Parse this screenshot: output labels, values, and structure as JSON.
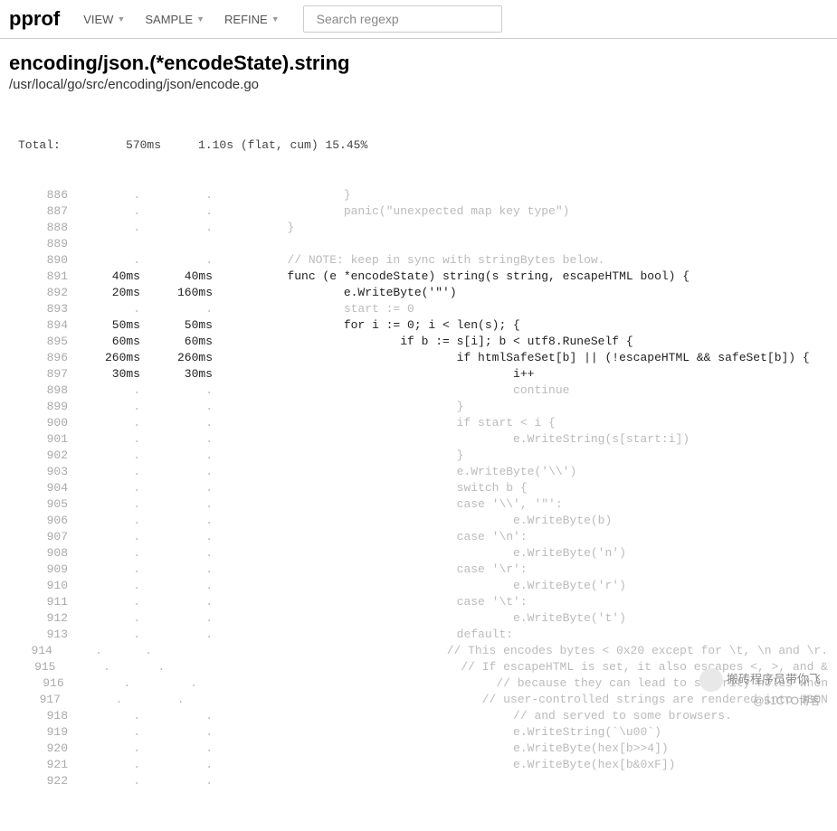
{
  "toolbar": {
    "brand": "pprof",
    "menus": [
      "VIEW",
      "SAMPLE",
      "REFINE"
    ],
    "search_placeholder": "Search regexp"
  },
  "heading": {
    "title": "encoding/json.(*encodeState).string",
    "path": "/usr/local/go/src/encoding/json/encode.go"
  },
  "totals": {
    "label": "Total:",
    "flat": "570ms",
    "cum": "1.10s",
    "meta": "(flat, cum) 15.45%"
  },
  "lines": [
    {
      "n": "886",
      "f": ".",
      "c": ".",
      "s": "                }",
      "m": true
    },
    {
      "n": "887",
      "f": ".",
      "c": ".",
      "s": "                panic(\"unexpected map key type\")",
      "m": true
    },
    {
      "n": "888",
      "f": ".",
      "c": ".",
      "s": "        }",
      "m": true
    },
    {
      "n": "889",
      "f": "",
      "c": "",
      "s": "",
      "m": true
    },
    {
      "n": "890",
      "f": ".",
      "c": ".",
      "s": "        // NOTE: keep in sync with stringBytes below.",
      "m": true,
      "comment": true
    },
    {
      "n": "891",
      "f": "40ms",
      "c": "40ms",
      "s": "        func (e *encodeState) string(s string, escapeHTML bool) {"
    },
    {
      "n": "892",
      "f": "20ms",
      "c": "160ms",
      "s": "                e.WriteByte('\"')"
    },
    {
      "n": "893",
      "f": ".",
      "c": ".",
      "s": "                start := 0",
      "m": true
    },
    {
      "n": "894",
      "f": "50ms",
      "c": "50ms",
      "s": "                for i := 0; i < len(s); {"
    },
    {
      "n": "895",
      "f": "60ms",
      "c": "60ms",
      "s": "                        if b := s[i]; b < utf8.RuneSelf {"
    },
    {
      "n": "896",
      "f": "260ms",
      "c": "260ms",
      "s": "                                if htmlSafeSet[b] || (!escapeHTML && safeSet[b]) {"
    },
    {
      "n": "897",
      "f": "30ms",
      "c": "30ms",
      "s": "                                        i++"
    },
    {
      "n": "898",
      "f": ".",
      "c": ".",
      "s": "                                        continue",
      "m": true
    },
    {
      "n": "899",
      "f": ".",
      "c": ".",
      "s": "                                }",
      "m": true
    },
    {
      "n": "900",
      "f": ".",
      "c": ".",
      "s": "                                if start < i {",
      "m": true
    },
    {
      "n": "901",
      "f": ".",
      "c": ".",
      "s": "                                        e.WriteString(s[start:i])",
      "m": true
    },
    {
      "n": "902",
      "f": ".",
      "c": ".",
      "s": "                                }",
      "m": true
    },
    {
      "n": "903",
      "f": ".",
      "c": ".",
      "s": "                                e.WriteByte('\\\\')",
      "m": true
    },
    {
      "n": "904",
      "f": ".",
      "c": ".",
      "s": "                                switch b {",
      "m": true
    },
    {
      "n": "905",
      "f": ".",
      "c": ".",
      "s": "                                case '\\\\', '\"':",
      "m": true
    },
    {
      "n": "906",
      "f": ".",
      "c": ".",
      "s": "                                        e.WriteByte(b)",
      "m": true
    },
    {
      "n": "907",
      "f": ".",
      "c": ".",
      "s": "                                case '\\n':",
      "m": true
    },
    {
      "n": "908",
      "f": ".",
      "c": ".",
      "s": "                                        e.WriteByte('n')",
      "m": true
    },
    {
      "n": "909",
      "f": ".",
      "c": ".",
      "s": "                                case '\\r':",
      "m": true
    },
    {
      "n": "910",
      "f": ".",
      "c": ".",
      "s": "                                        e.WriteByte('r')",
      "m": true
    },
    {
      "n": "911",
      "f": ".",
      "c": ".",
      "s": "                                case '\\t':",
      "m": true
    },
    {
      "n": "912",
      "f": ".",
      "c": ".",
      "s": "                                        e.WriteByte('t')",
      "m": true
    },
    {
      "n": "913",
      "f": ".",
      "c": ".",
      "s": "                                default:",
      "m": true
    },
    {
      "n": "914",
      "f": ".",
      "c": ".",
      "s": "                                        // This encodes bytes < 0x20 except for \\t, \\n and \\r.",
      "m": true,
      "comment": true
    },
    {
      "n": "915",
      "f": ".",
      "c": ".",
      "s": "                                        // If escapeHTML is set, it also escapes <, >, and &",
      "m": true,
      "comment": true
    },
    {
      "n": "916",
      "f": ".",
      "c": ".",
      "s": "                                        // because they can lead to security holes when",
      "m": true,
      "comment": true
    },
    {
      "n": "917",
      "f": ".",
      "c": ".",
      "s": "                                        // user-controlled strings are rendered into JSON",
      "m": true,
      "comment": true
    },
    {
      "n": "918",
      "f": ".",
      "c": ".",
      "s": "                                        // and served to some browsers.",
      "m": true,
      "comment": true
    },
    {
      "n": "919",
      "f": ".",
      "c": ".",
      "s": "                                        e.WriteString(`\\u00`)",
      "m": true
    },
    {
      "n": "920",
      "f": ".",
      "c": ".",
      "s": "                                        e.WriteByte(hex[b>>4])",
      "m": true
    },
    {
      "n": "921",
      "f": ".",
      "c": ".",
      "s": "                                        e.WriteByte(hex[b&0xF])",
      "m": true
    },
    {
      "n": "922",
      "f": ".",
      "c": ".",
      "s": "",
      "m": true
    }
  ],
  "watermark": {
    "line1": "搬砖程序员带你飞",
    "line2": "@51CTO博客"
  }
}
